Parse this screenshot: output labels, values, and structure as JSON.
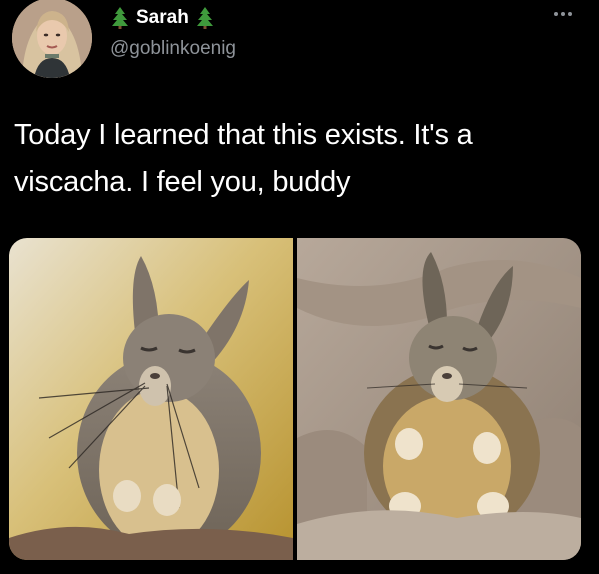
{
  "tweet": {
    "author_name": "Sarah",
    "author_handle": "@goblinkoenig",
    "text": "Today I learned that this exists. It's a viscacha. I feel you, buddy",
    "name_emoji_icon": "evergreen-tree-icon",
    "more_icon": "more-dots-icon"
  },
  "media": {
    "photo_count": 2
  },
  "colors": {
    "background": "#000000",
    "text_primary": "#ffffff",
    "text_secondary": "#8e9399",
    "tree_green": "#3f9a3c"
  }
}
